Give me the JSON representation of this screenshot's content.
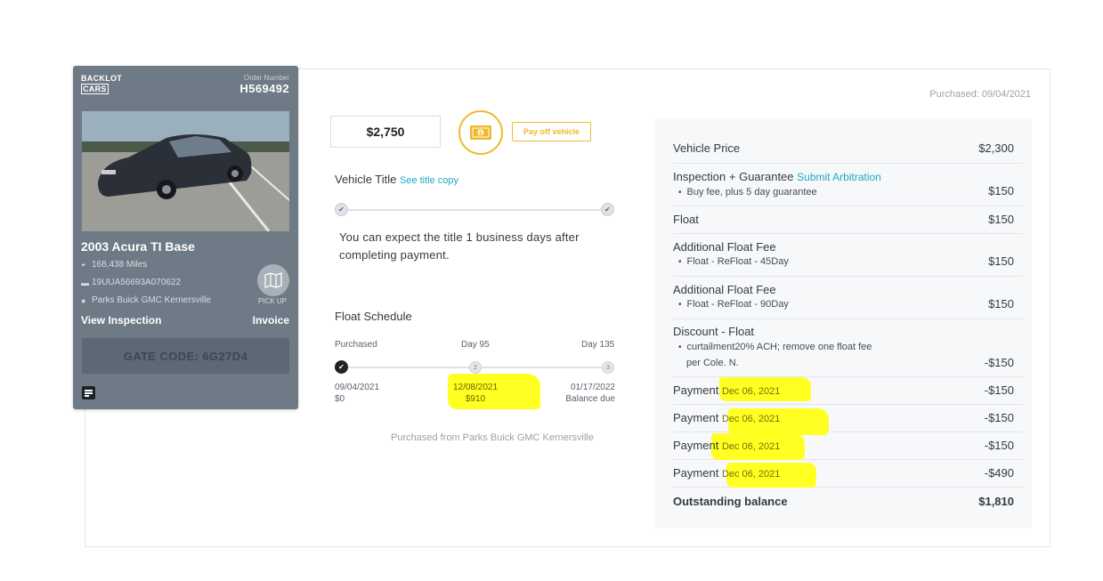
{
  "card": {
    "logo_line1": "BACKLOT",
    "logo_line2": "CARS",
    "order_label": "Order Number",
    "order_number": "H569492",
    "vehicle_title": "2003 Acura TI Base",
    "miles": "168,438 Miles",
    "vin": "19UUA56693A070622",
    "seller": "Parks Buick GMC Kernersville",
    "pickup_label": "PICK UP",
    "view_inspection": "View Inspection",
    "invoice": "Invoice",
    "gate_code": "GATE CODE: 6G27D4",
    "icons": [
      "speedometer-icon",
      "car-icon",
      "person-icon",
      "map-icon",
      "note-icon"
    ]
  },
  "payoff": {
    "amount": "$2,750",
    "button": "Pay off vehicle",
    "icon": "money-icon",
    "accent": "#f0b92b"
  },
  "vehicle_title": {
    "label": "Vehicle Title",
    "link": "See title copy",
    "message": "You can expect the title 1 business days after completing payment."
  },
  "float_schedule": {
    "label": "Float Schedule",
    "steps": [
      {
        "top": "Purchased",
        "marker": "",
        "date": "09/04/2021",
        "amount": "$0"
      },
      {
        "top": "Day 95",
        "marker": "2",
        "date": "12/08/2021",
        "amount": "$910"
      },
      {
        "top": "Day 135",
        "marker": "3",
        "date": "01/17/2022",
        "amount": "Balance due"
      }
    ],
    "purchased_from": "Purchased from Parks Buick GMC Kernersville"
  },
  "summary": {
    "purchased_date": "Purchased: 09/04/2021",
    "rows": [
      {
        "label": "Vehicle Price",
        "amount": "$2,300"
      },
      {
        "label": "Inspection + Guarantee",
        "link": "Submit Arbitration",
        "sub": "Buy fee, plus 5 day guarantee",
        "amount": "$150"
      },
      {
        "label": "Float",
        "amount": "$150"
      },
      {
        "label": "Additional Float Fee",
        "sub": "Float - ReFloat - 45Day",
        "amount": "$150"
      },
      {
        "label": "Additional Float Fee",
        "sub": "Float - ReFloat - 90Day",
        "amount": "$150"
      },
      {
        "label": "Discount - Float",
        "sub": "curtailment20% ACH; remove one float fee",
        "sub2": "per Cole. N.",
        "amount": "-$150"
      },
      {
        "label": "Payment",
        "date": "Dec 06, 2021",
        "amount": "-$150"
      },
      {
        "label": "Payment",
        "date": "Dec 06, 2021",
        "amount": "-$150"
      },
      {
        "label": "Payment",
        "date": "Dec 06, 2021",
        "amount": "-$150"
      },
      {
        "label": "Payment",
        "date": "Dec 06, 2021",
        "amount": "-$490"
      }
    ],
    "total_label": "Outstanding balance",
    "total_amount": "$1,810"
  },
  "colors": {
    "link": "#20a7c9",
    "card_bg": "#6e7a86",
    "highlight": "#ffff22"
  }
}
